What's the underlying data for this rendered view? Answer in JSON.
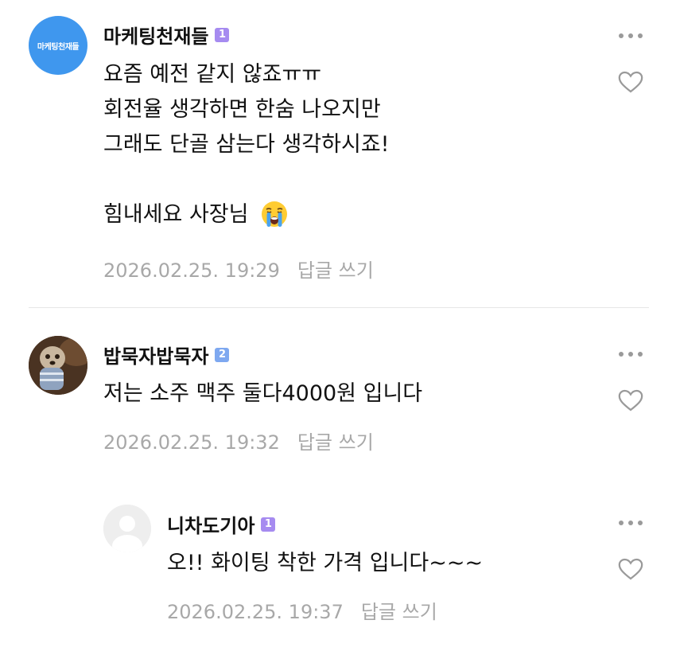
{
  "comments": [
    {
      "author": "마케팅천재들",
      "badge": "1",
      "avatar_text": "마케팅천재들",
      "lines": [
        "요즘 예전 같지 않죠ㅠㅠ",
        "회전율 생각하면 한숨 나오지만",
        "그래도 단골 삼는다 생각하시죠!",
        "",
        "힘내세요 사장님"
      ],
      "emoji": "loudly-crying-face",
      "timestamp": "2026.02.25. 19:29",
      "reply_label": "답글 쓰기"
    },
    {
      "author": "밥묵자밥묵자",
      "badge": "2",
      "lines": [
        "저는 소주 맥주 둘다4000원 입니다"
      ],
      "timestamp": "2026.02.25. 19:32",
      "reply_label": "답글 쓰기"
    },
    {
      "author": "니차도기아",
      "badge": "1",
      "lines": [
        "오!! 화이팅 착한 가격 입니다~~~"
      ],
      "timestamp": "2026.02.25. 19:37",
      "reply_label": "답글 쓰기"
    }
  ],
  "colors": {
    "badge_level1": "#a68bf0",
    "badge_level2": "#7ea8f0",
    "avatar_brand": "#3f97ee",
    "meta_text": "#a8a8a8"
  },
  "icons": [
    "more-options-icon",
    "heart-icon",
    "default-avatar-icon"
  ]
}
